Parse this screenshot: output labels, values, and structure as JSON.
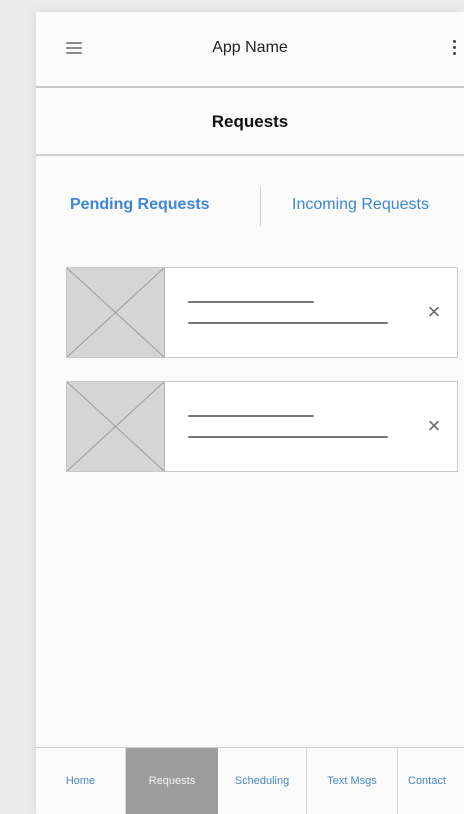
{
  "app_bar": {
    "title": "App Name",
    "menu_icon": "hamburger-menu-icon",
    "overflow_icon": "more-vertical-icon"
  },
  "page": {
    "title": "Requests"
  },
  "tabs": [
    {
      "label": "Pending Requests",
      "active": true
    },
    {
      "label": "Incoming Requests",
      "active": false
    }
  ],
  "requests": [
    {
      "image": "image-placeholder-icon",
      "remove_icon": "close-icon",
      "remove_glyph": "×"
    },
    {
      "image": "image-placeholder-icon",
      "remove_icon": "close-icon",
      "remove_glyph": "×"
    }
  ],
  "bottom_nav": {
    "items": [
      {
        "label": "Home",
        "active": false
      },
      {
        "label": "Requests",
        "active": true
      },
      {
        "label": "Scheduling",
        "active": false
      },
      {
        "label": "Text Msgs",
        "active": false
      },
      {
        "label": "Contact",
        "active": false
      }
    ]
  },
  "colors": {
    "accent": "#3f86d8",
    "active_nav_bg": "#9d9d9d",
    "background": "#fbfbfb"
  }
}
